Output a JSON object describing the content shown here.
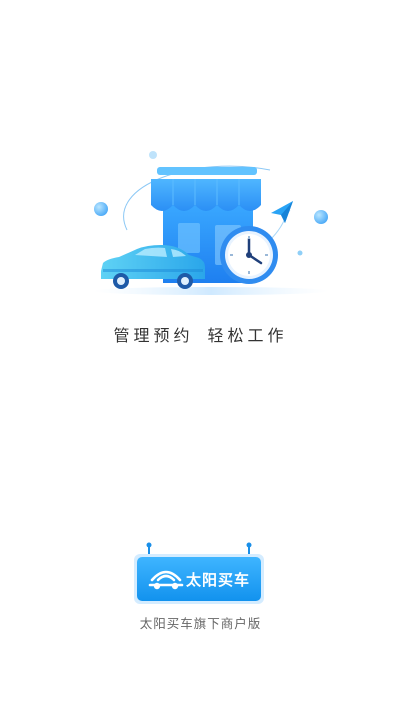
{
  "slogan": {
    "part1": "管理预约",
    "part2": "轻松工作"
  },
  "brand": {
    "name": "太阳买车",
    "subtitle": "太阳买车旗下商户版"
  },
  "colors": {
    "accent": "#1aa0f5",
    "accent_light": "#7dd3fc",
    "text_dark": "#333333",
    "text_gray": "#666666"
  },
  "icons": [
    "shop-icon",
    "car-icon",
    "clock-icon",
    "paper-plane-icon",
    "brand-car-logo-icon"
  ]
}
